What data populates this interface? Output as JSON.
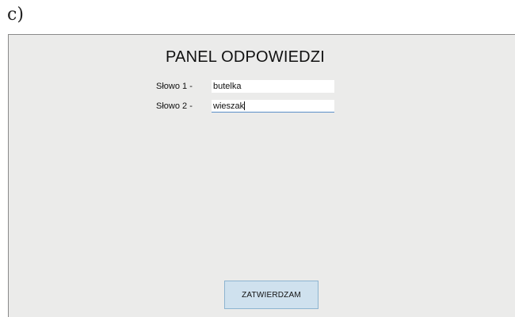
{
  "figure": {
    "label": "c)"
  },
  "panel": {
    "title": "PANEL ODPOWIEDZI",
    "fields": [
      {
        "label": "Słowo 1 -",
        "value": "butelka"
      },
      {
        "label": "Słowo 2 -",
        "value": "wieszak"
      }
    ],
    "submit_label": "ZATWIERDZAM"
  },
  "colors": {
    "panel_background": "#ebebea",
    "button_background": "#cfe1ee",
    "button_border": "#8db4d0",
    "focus_underline": "#5a8ec8"
  }
}
